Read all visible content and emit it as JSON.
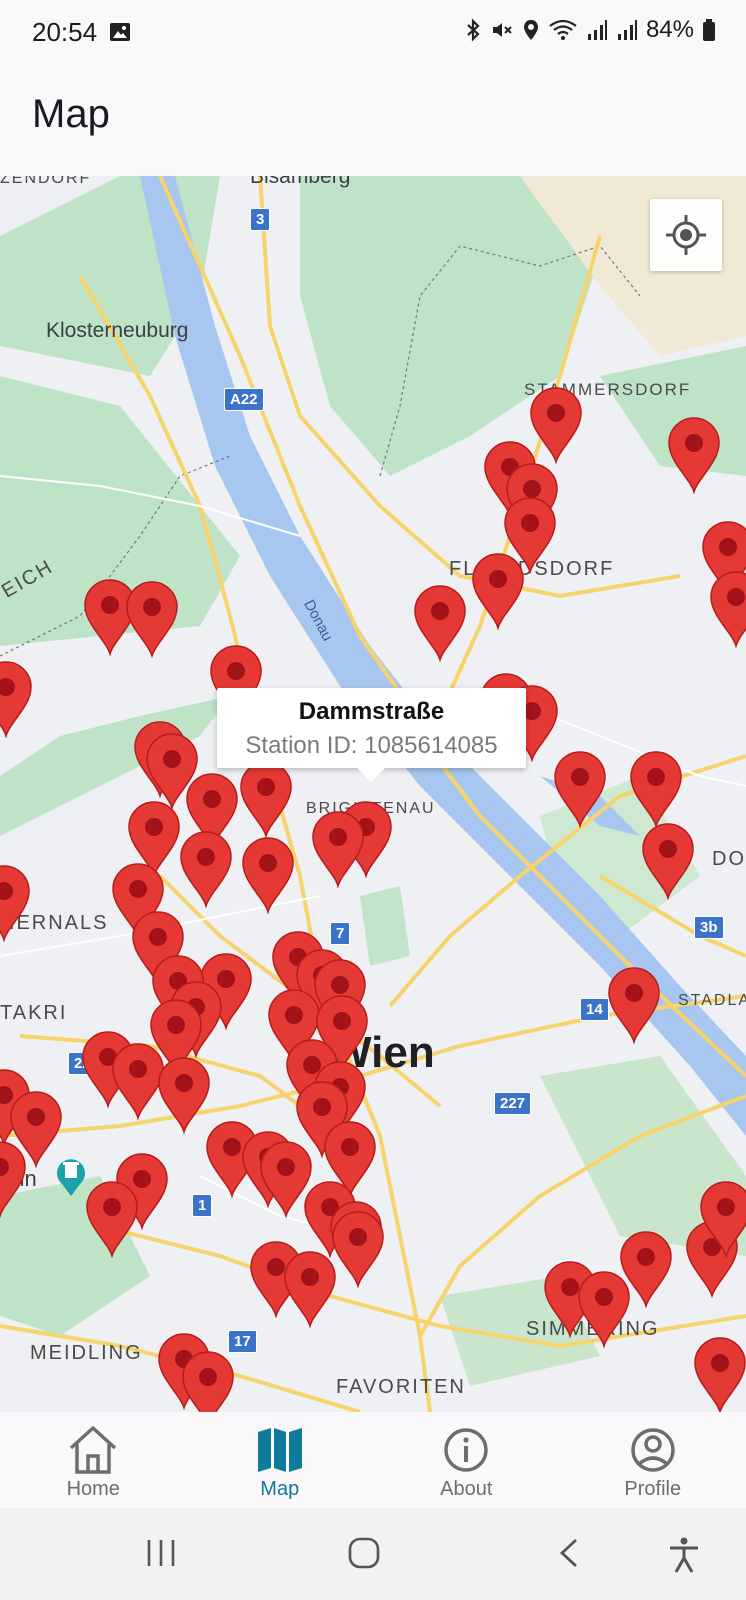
{
  "status_bar": {
    "time": "20:54",
    "battery": "84%",
    "icons": [
      "image-icon",
      "bluetooth-icon",
      "vibrate-off-icon",
      "location-icon",
      "wifi-icon",
      "signal-icon",
      "signal-icon",
      "battery-icon"
    ]
  },
  "app_bar": {
    "title": "Map"
  },
  "map": {
    "labels": {
      "zendorf": "ZENDORF",
      "bisamberg": "Bisamberg",
      "klosterneuburg": "Klosterneuburg",
      "stammersdorf": "STAMMERSDORF",
      "floridsdorf": "FLORIDSDORF",
      "eich": "EICH",
      "hernals": "HERNALS",
      "ottakring": "TAKRI",
      "brigittenau": "BRIGITTENAU",
      "donau": "Donau",
      "wien": "Wien",
      "stadlau": "STADLA",
      "unn": "unn",
      "simmering": "SIMMERING",
      "meidling": "MEIDLING",
      "favoriten": "FAVORITEN",
      "do": "DO"
    },
    "shields": [
      "3",
      "A22",
      "223",
      "1",
      "17",
      "227",
      "14",
      "3b",
      "7"
    ],
    "info_window": {
      "title": "Dammstraße",
      "subtitle": "Station ID: 1085614085"
    },
    "pin_color": "#e53935"
  },
  "bottom_nav": {
    "items": [
      {
        "label": "Home",
        "icon": "home-icon"
      },
      {
        "label": "Map",
        "icon": "map-icon",
        "active": true
      },
      {
        "label": "About",
        "icon": "info-icon"
      },
      {
        "label": "Profile",
        "icon": "profile-icon"
      }
    ],
    "active_color": "#0e7a9c"
  },
  "system_nav": [
    "recent-apps-icon",
    "home-circle-icon",
    "back-icon",
    "accessibility-icon"
  ]
}
